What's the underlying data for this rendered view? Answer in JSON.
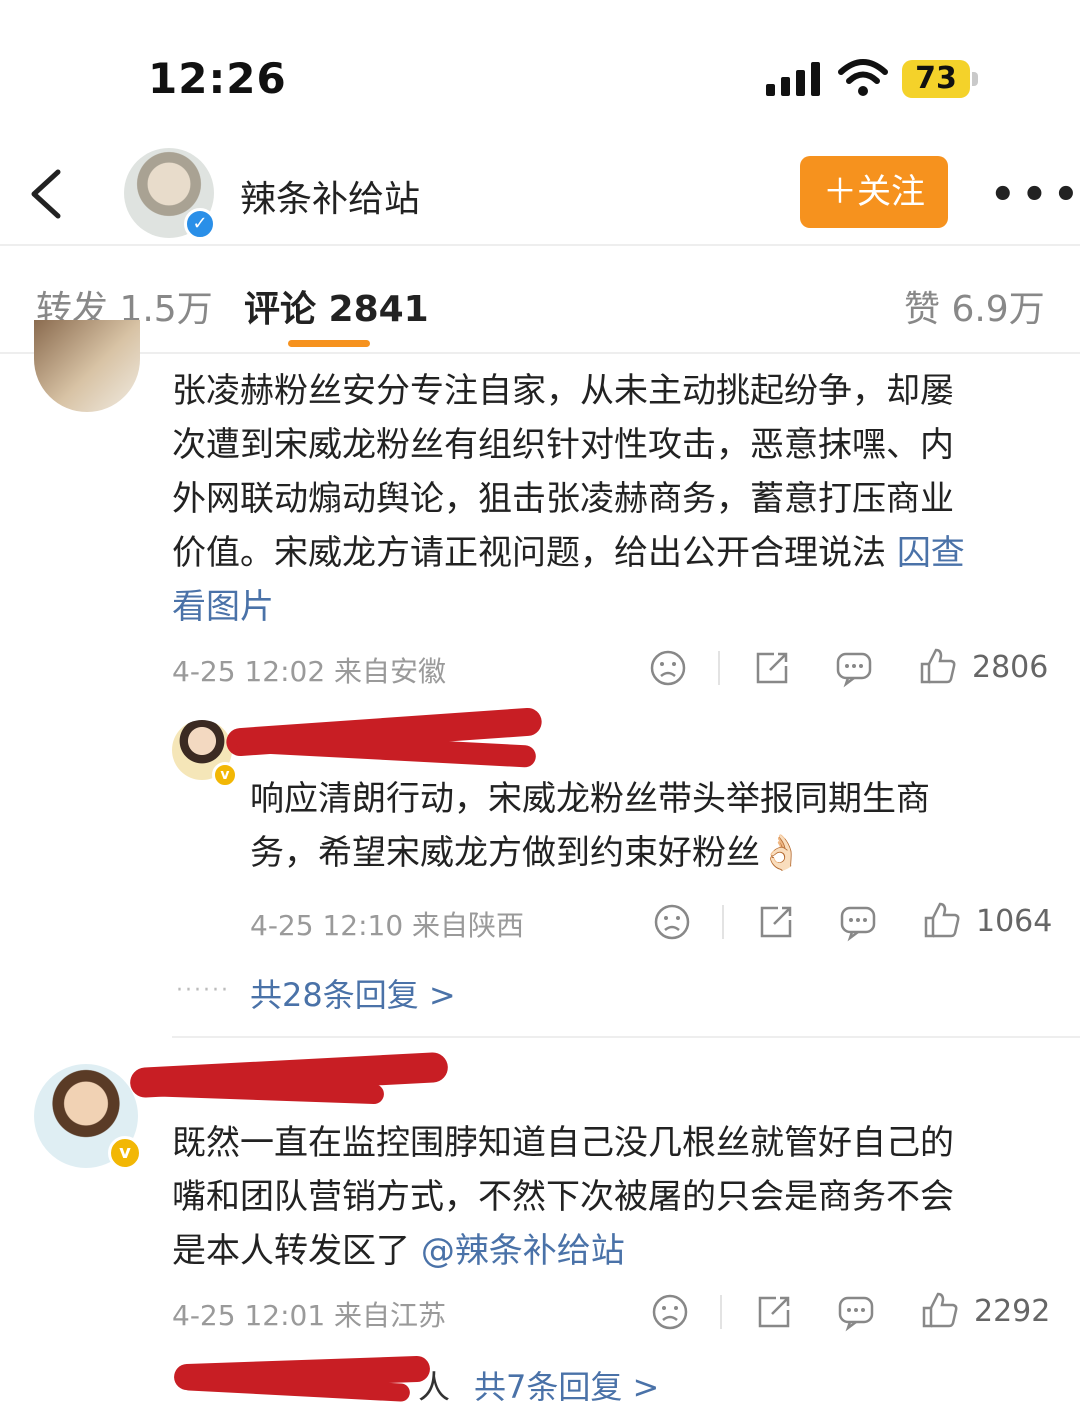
{
  "status_bar": {
    "time": "12:26",
    "battery": "73"
  },
  "header": {
    "title": "辣条补给站",
    "follow_label": "＋关注",
    "more_label": "•••"
  },
  "tabs": {
    "repost": "转发 1.5万",
    "comment": "评论 2841",
    "like": "赞 6.9万"
  },
  "comments": [
    {
      "lines": [
        "张凌赫粉丝安分专注自家，从未主动挑起纷争，却屡",
        "次遭到宋威龙粉丝有组织针对性攻击，恶意抹嘿、内",
        "外网联动煽动舆论，狙击张凌赫商务，蓄意打压商业",
        "价值。宋威龙方请正视问题，给出公开合理说法"
      ],
      "link_part1": "囚查",
      "link_part2": "看图片",
      "meta": "4-25 12:02  来自安徽",
      "likes": "2806",
      "reply": {
        "lines": [
          "响应清朗行动，宋威龙粉丝带头举报同期生商",
          "务，希望宋威龙方做到约束好粉丝👌🏻"
        ],
        "meta": "4-25 12:10  来自陕西",
        "likes": "1064"
      },
      "replies_label": "共28条回复 >"
    },
    {
      "lines": [
        "既然一直在监控围脖知道自己没几根丝就管好自己的",
        "嘴和团队营销方式，不然下次被屠的只会是商务不会",
        "是本人转发区了"
      ],
      "mention": "@辣条补给站",
      "meta": "4-25 12:01  来自江苏",
      "likes": "2292",
      "replies_label": "共7条回复 >",
      "replies_prefix": "人"
    }
  ],
  "colors": {
    "accent": "#f6921e",
    "link": "#4a72a8",
    "verify_blue": "#2a8fe8",
    "verify_gold": "#f2b705"
  }
}
